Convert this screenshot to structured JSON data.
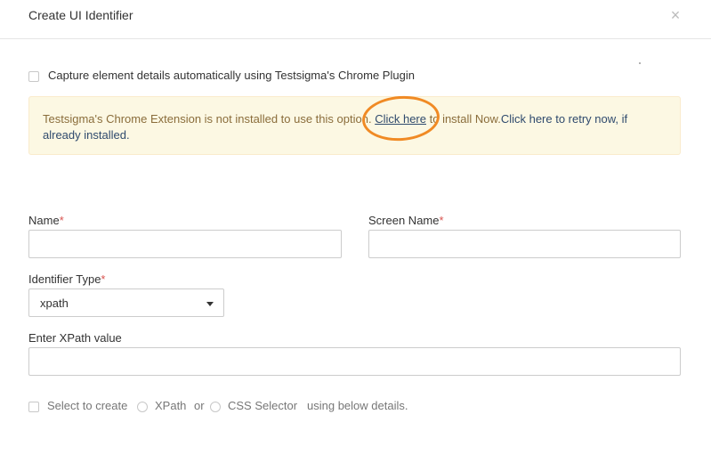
{
  "dialog": {
    "title": "Create UI Identifier",
    "close_icon": "×"
  },
  "capture": {
    "label": "Capture element details automatically using Testsigma's Chrome Plugin",
    "checked": false
  },
  "alert": {
    "text_before": "Testsigma's Chrome Extension is not installed to use this option.",
    "install_link": "Click here",
    "install_suffix": "to install Now.",
    "retry_link": "Click here to retry now, if already installed.",
    "annotation_color": "#f08a24"
  },
  "form": {
    "name_label": "Name",
    "screen_name_label": "Screen Name",
    "required_mark": "*",
    "identifier_type_label": "Identifier Type",
    "identifier_type_value": "xpath",
    "xpath_label": "Enter XPath value"
  },
  "builder": {
    "select_label": "Select to create",
    "xpath_option": "XPath",
    "or_text": "or",
    "css_option": "CSS Selector",
    "suffix": "using below details."
  }
}
